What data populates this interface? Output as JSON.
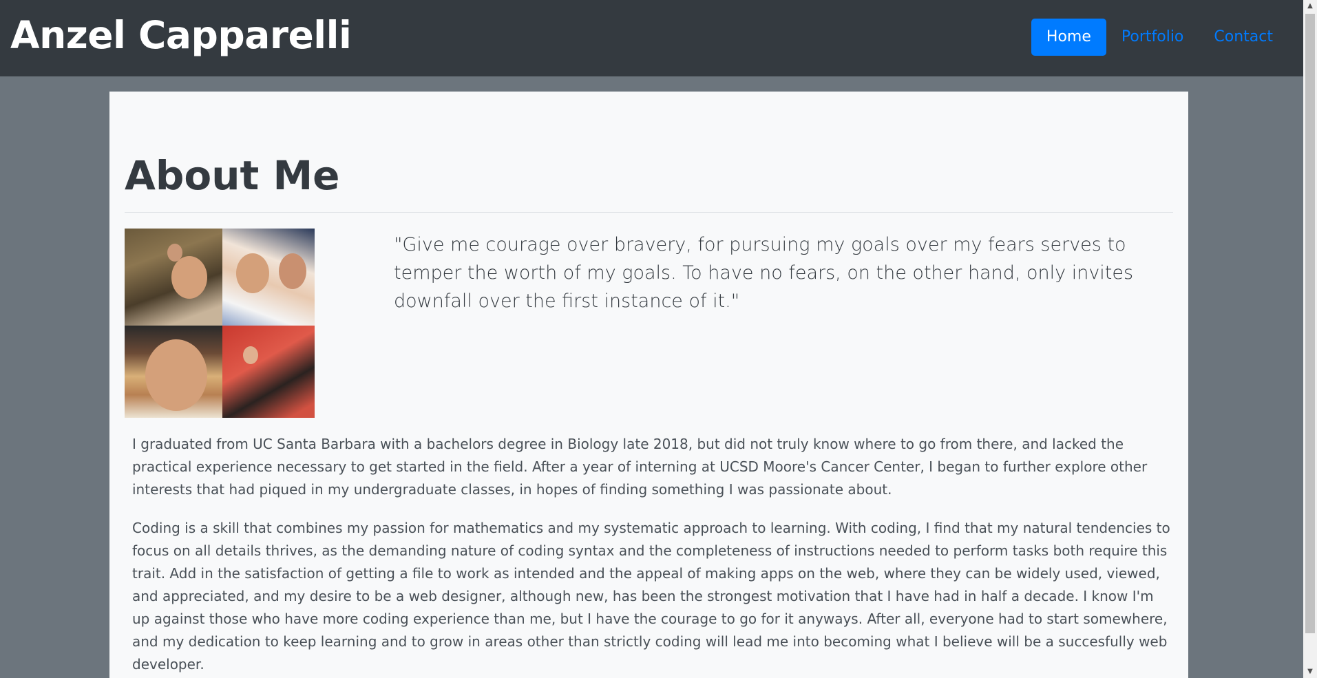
{
  "navbar": {
    "brand": "Anzel Capparelli",
    "links": [
      {
        "label": "Home",
        "active": true
      },
      {
        "label": "Portfolio",
        "active": false
      },
      {
        "label": "Contact",
        "active": false
      }
    ]
  },
  "main": {
    "title": "About Me",
    "quote": "\"Give me courage over bravery, for pursuing my goals over my fears serves to temper the worth of my goals. To have no fears, on the other hand, only invites downfall over the first instance of it.\"",
    "paragraphs": [
      "I graduated from UC Santa Barbara with a bachelors degree in Biology late 2018, but did not truly know where to go from there, and lacked the practical experience necessary to get started in the field. After a year of interning at UCSD Moore's Cancer Center, I began to further explore other interests that had piqued in my undergraduate classes, in hopes of finding something I was passionate about.",
      "Coding is a skill that combines my passion for mathematics and my systematic approach to learning. With coding, I find that my natural tendencies to focus on all details thrives, as the demanding nature of coding syntax and the completeness of instructions needed to perform tasks both require this trait. Add in the satisfaction of getting a file to work as intended and the appeal of making apps on the web, where they can be widely used, viewed, and appreciated, and my desire to be a web designer, although new, has been the strongest motivation that I have had in half a decade. I know I'm up against those who have more coding experience than me, but I have the courage to go for it anyways. After all, everyone had to start somewhere, and my dedication to keep learning and to grow in areas other than strictly coding will lead me into becoming what I believe will be a succesfully web developer."
    ]
  },
  "colors": {
    "navbar_bg": "#343a40",
    "page_bg": "#6c757d",
    "card_bg": "#f8f9fa",
    "accent": "#007bff"
  }
}
